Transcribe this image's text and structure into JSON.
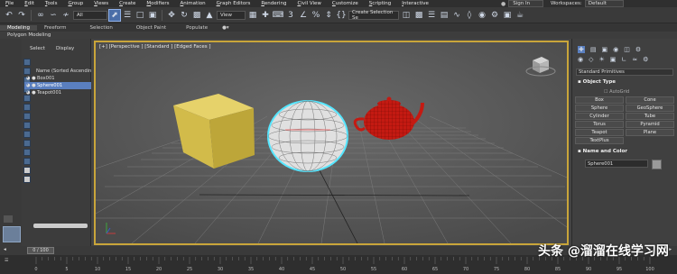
{
  "menubar": {
    "items": [
      "File",
      "Edit",
      "Tools",
      "Group",
      "Views",
      "Create",
      "Modifiers",
      "Animation",
      "Graph Editors",
      "Rendering",
      "Civil View",
      "Customize",
      "Scripting",
      "Interactive"
    ],
    "signin": "Sign In",
    "workspaces_label": "Workspaces:",
    "workspaces_value": "Default"
  },
  "toolbar": {
    "filter_value": "All",
    "refcoord_value": "View",
    "selection_set_placeholder": "Create Selection Se"
  },
  "ribbon": {
    "tabs": [
      "Modeling",
      "Freeform",
      "Selection",
      "Object Paint",
      "Populate"
    ],
    "active_tab": "Modeling",
    "subtitle": "Polygon Modeling"
  },
  "explorer": {
    "tabs": [
      "Select",
      "Display"
    ],
    "header": "Name (Sorted Ascendin",
    "objects": [
      "Box001",
      "Sphere001",
      "Teapot001"
    ],
    "selected": "Sphere001"
  },
  "viewport": {
    "label": "[+] [Perspective ] [Standard ] [Edged Faces ]"
  },
  "command_panel": {
    "category": "Standard Primitives",
    "object_type_title": "Object Type",
    "autogrid": "AutoGrid",
    "buttons": [
      "Box",
      "Cone",
      "Sphere",
      "GeoSphere",
      "Cylinder",
      "Tube",
      "Torus",
      "Pyramid",
      "Teapot",
      "Plane",
      "TextPlus"
    ],
    "name_color_title": "Name and Color",
    "object_name": "Sphere001",
    "object_color": "#9a9a9a"
  },
  "timeline": {
    "frame_display": "0 / 100",
    "ticks": [
      "0",
      "5",
      "10",
      "15",
      "20",
      "25",
      "30",
      "35",
      "40",
      "45",
      "50",
      "55",
      "60",
      "65",
      "70",
      "75",
      "80",
      "85",
      "90",
      "95",
      "100"
    ]
  },
  "watermark": "头条 @溜溜在线学习网",
  "colors": {
    "accent_blue": "#5a7fbf",
    "viewport_border": "#c9a53a",
    "box_yellow": "#d8c04e",
    "teapot_red": "#cc1a12",
    "sphere_select": "#55e6ff"
  }
}
